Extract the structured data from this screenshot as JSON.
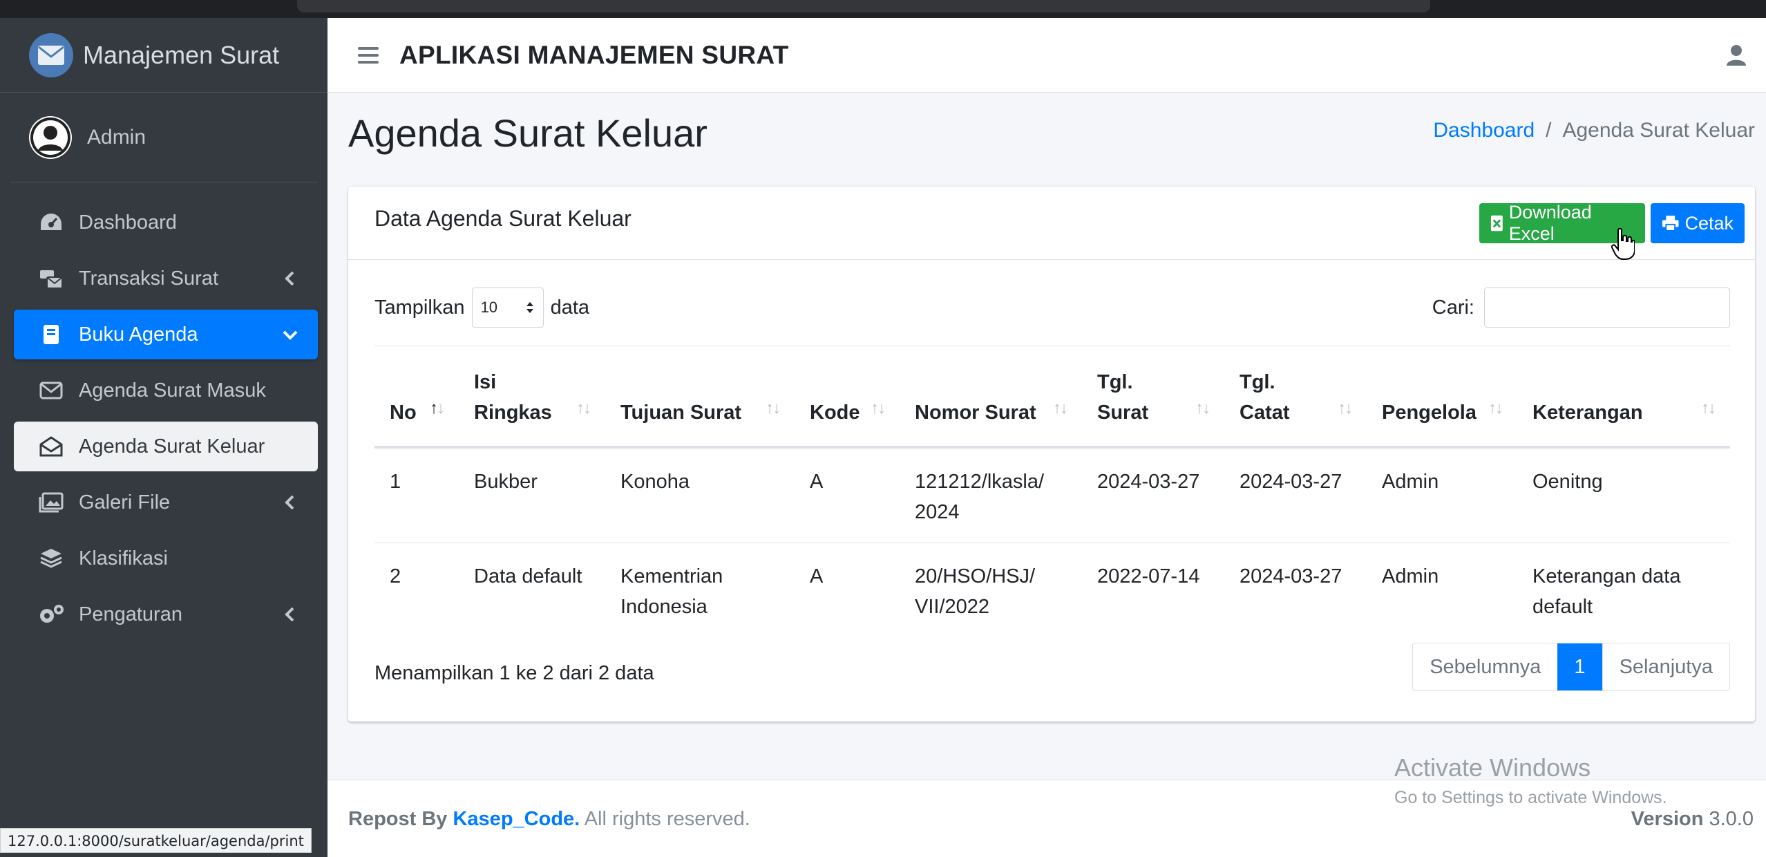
{
  "browser": {
    "status_url": "127.0.0.1:8000/suratkeluar/agenda/print"
  },
  "sidebar": {
    "brand": "Manajemen Surat",
    "user": "Admin",
    "items": [
      {
        "label": "Dashboard",
        "icon": "tachometer-icon"
      },
      {
        "label": "Transaksi Surat",
        "icon": "mail-bulk-icon",
        "chevron": "left"
      },
      {
        "label": "Buku Agenda",
        "icon": "book-icon",
        "chevron": "down"
      },
      {
        "label": "Agenda Surat Masuk",
        "icon": "envelope-icon"
      },
      {
        "label": "Agenda Surat Keluar",
        "icon": "envelope-open-icon"
      },
      {
        "label": "Galeri File",
        "icon": "images-icon",
        "chevron": "left"
      },
      {
        "label": "Klasifikasi",
        "icon": "layer-group-icon"
      },
      {
        "label": "Pengaturan",
        "icon": "cogs-icon",
        "chevron": "left"
      }
    ]
  },
  "header": {
    "title": "APLIKASI MANAJEMEN SURAT"
  },
  "content": {
    "page_title": "Agenda Surat Keluar",
    "breadcrumb": {
      "home": "Dashboard",
      "separator": "/",
      "current": "Agenda Surat Keluar"
    }
  },
  "card": {
    "title": "Data Agenda Surat Keluar",
    "download_label": "Download Excel",
    "print_label": "Cetak",
    "show_label": "Tampilkan",
    "show_value": "10",
    "show_suffix": "data",
    "search_label": "Cari:",
    "search_value": ""
  },
  "table": {
    "columns": [
      [
        "No"
      ],
      [
        "Isi",
        "Ringkas"
      ],
      [
        "Tujuan Surat"
      ],
      [
        "Kode"
      ],
      [
        "Nomor Surat"
      ],
      [
        "Tgl.",
        "Surat"
      ],
      [
        "Tgl.",
        "Catat"
      ],
      [
        "Pengelola"
      ],
      [
        "Keterangan"
      ]
    ],
    "rows": [
      {
        "no": "1",
        "isi": "Bukber",
        "tujuan": "Konoha",
        "kode": "A",
        "nomor_1": "121212/lkasla/",
        "nomor_2": "2024",
        "tgl_surat": "2024-03-27",
        "tgl_catat": "2024-03-27",
        "pengelola": "Admin",
        "ket_1": "Oenitng",
        "ket_2": ""
      },
      {
        "no": "2",
        "isi": "Data default",
        "tujuan_1": "Kementrian",
        "tujuan_2": "Indonesia",
        "kode": "A",
        "nomor_1": "20/HSO/HSJ/",
        "nomor_2": "VII/2022",
        "tgl_surat": "2022-07-14",
        "tgl_catat": "2024-03-27",
        "pengelola": "Admin",
        "ket_1": "Keterangan data",
        "ket_2": "default"
      }
    ],
    "info": "Menampilkan 1 ke 2 dari 2 data"
  },
  "pagination": {
    "prev": "Sebelumnya",
    "current": "1",
    "next": "Selanjutya"
  },
  "footer": {
    "repost": "Repost By",
    "author": "Kasep_Code.",
    "rights": "All rights reserved.",
    "version_label": "Version",
    "version": "3.0.0"
  },
  "watermark": {
    "line1": "Activate Windows",
    "line2": "Go to Settings to activate Windows."
  },
  "colors": {
    "primary": "#007bff",
    "success": "#28a745",
    "sidebar": "#343a40"
  }
}
